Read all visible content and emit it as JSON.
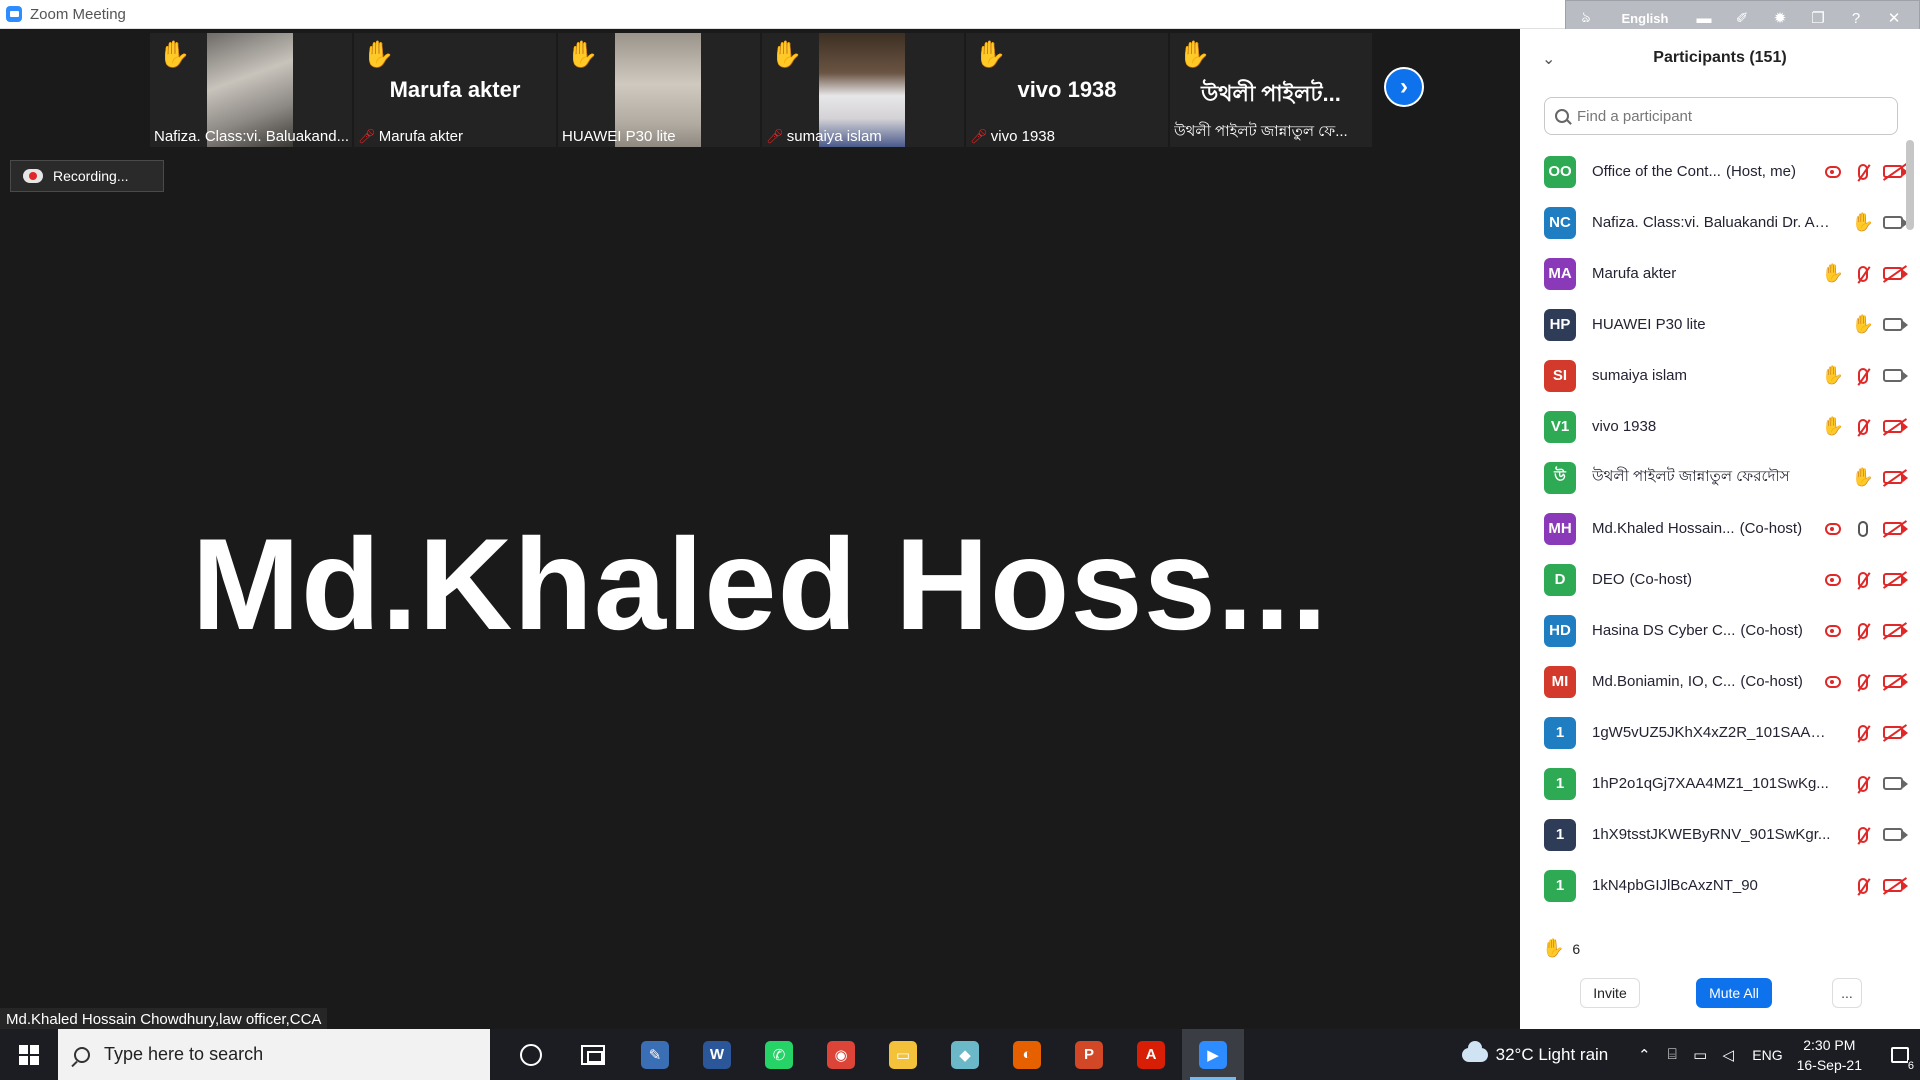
{
  "window": {
    "title": "Zoom Meeting"
  },
  "langbar": {
    "language": "English"
  },
  "thumbnails": [
    {
      "display": "photo",
      "name": "Nafiza. Class:vi. Baluakand...",
      "muted": false
    },
    {
      "display": "name",
      "big_name": "Marufa akter",
      "name": "Marufa akter",
      "muted": true
    },
    {
      "display": "photo",
      "name": "HUAWEI P30 lite",
      "muted": false
    },
    {
      "display": "photo",
      "name": "sumaiya islam",
      "muted": true
    },
    {
      "display": "name",
      "big_name": "vivo 1938",
      "name": "vivo 1938",
      "muted": true
    },
    {
      "display": "name",
      "big_name": "উথলী পাইলট...",
      "name": "উথলী পাইলট জান্নাতুল ফে...",
      "muted": false
    }
  ],
  "recording": {
    "label": "Recording..."
  },
  "active_speaker": {
    "big_name": "Md.Khaled  Hoss...",
    "name_label": "Md.Khaled Hossain Chowdhury,law officer,CCA"
  },
  "participants_panel": {
    "title": "Participants (151)",
    "search_placeholder": "Find a participant",
    "participants": [
      {
        "initials": "OO",
        "color": "#2eaa55",
        "name": "Office of the Cont...",
        "role": "(Host, me)",
        "rec": true,
        "hand": false,
        "mic": "off",
        "cam": "off"
      },
      {
        "initials": "NC",
        "color": "#1f7ec1",
        "name": "Nafiza. Class:vi. Baluakandi Dr. Ab...",
        "role": "",
        "rec": false,
        "hand": true,
        "mic": "none",
        "cam": "on"
      },
      {
        "initials": "MA",
        "color": "#8a3ab9",
        "name": "Marufa akter",
        "role": "",
        "rec": false,
        "hand": true,
        "mic": "off",
        "cam": "off"
      },
      {
        "initials": "HP",
        "color": "#2f3c58",
        "name": "HUAWEI P30 lite",
        "role": "",
        "rec": false,
        "hand": true,
        "mic": "none",
        "cam": "on"
      },
      {
        "initials": "SI",
        "color": "#d33a2c",
        "name": "sumaiya islam",
        "role": "",
        "rec": false,
        "hand": true,
        "mic": "off",
        "cam": "on"
      },
      {
        "initials": "V1",
        "color": "#2eaa55",
        "name": "vivo 1938",
        "role": "",
        "rec": false,
        "hand": true,
        "mic": "off",
        "cam": "off"
      },
      {
        "initials": "উ",
        "color": "#2eaa55",
        "name": "উথলী পাইলট জান্নাতুল ফেরদৌস",
        "role": "",
        "rec": false,
        "hand": true,
        "mic": "none",
        "cam": "off"
      },
      {
        "initials": "MH",
        "color": "#8a3ab9",
        "name": "Md.Khaled Hossain...",
        "role": "(Co-host)",
        "rec": true,
        "hand": false,
        "mic": "on",
        "cam": "off"
      },
      {
        "initials": "D",
        "color": "#2eaa55",
        "name": "DEO",
        "role": "(Co-host)",
        "rec": true,
        "hand": false,
        "mic": "off",
        "cam": "off"
      },
      {
        "initials": "HD",
        "color": "#1f7ec1",
        "name": "Hasina DS Cyber C...",
        "role": "(Co-host)",
        "rec": true,
        "hand": false,
        "mic": "off",
        "cam": "off"
      },
      {
        "initials": "MI",
        "color": "#d33a2c",
        "name": "Md.Boniamin, IO, C...",
        "role": "(Co-host)",
        "rec": true,
        "hand": false,
        "mic": "off",
        "cam": "off"
      },
      {
        "initials": "1",
        "color": "#1f7ec1",
        "name": "1gW5vUZ5JKhX4xZ2R_101SAAA...",
        "role": "",
        "rec": false,
        "hand": false,
        "mic": "off",
        "cam": "off"
      },
      {
        "initials": "1",
        "color": "#2eaa55",
        "name": "1hP2o1qGj7XAA4MZ1_101SwKg...",
        "role": "",
        "rec": false,
        "hand": false,
        "mic": "off",
        "cam": "on"
      },
      {
        "initials": "1",
        "color": "#2f3c58",
        "name": "1hX9tsstJKWEByRNV_901SwKgr...",
        "role": "",
        "rec": false,
        "hand": false,
        "mic": "off",
        "cam": "on"
      },
      {
        "initials": "1",
        "color": "#2eaa55",
        "name": "1kN4pbGIJlBcAxzNT_90",
        "role": "",
        "rec": false,
        "hand": false,
        "mic": "off",
        "cam": "off"
      }
    ],
    "raised_hands_count": "6",
    "invite_label": "Invite",
    "mute_all_label": "Mute All",
    "more_label": "..."
  },
  "taskbar": {
    "search_placeholder": "Type here to search",
    "apps": [
      {
        "name": "paint-icon",
        "glyph": "✎",
        "color": "#3a6fb5"
      },
      {
        "name": "word-icon",
        "glyph": "W",
        "color": "#2b579a"
      },
      {
        "name": "whatsapp-icon",
        "glyph": "✆",
        "color": "#25d366"
      },
      {
        "name": "chrome-icon",
        "glyph": "◉",
        "color": "#db4437"
      },
      {
        "name": "file-explorer-icon",
        "glyph": "▭",
        "color": "#f3c13a"
      },
      {
        "name": "notes-icon",
        "glyph": "◆",
        "color": "#6bb8c9"
      },
      {
        "name": "firefox-icon",
        "glyph": "◐",
        "color": "#e66000"
      },
      {
        "name": "powerpoint-icon",
        "glyph": "P",
        "color": "#d24726"
      },
      {
        "name": "acrobat-icon",
        "glyph": "A",
        "color": "#d81e05"
      },
      {
        "name": "zoom-icon",
        "glyph": "▶",
        "color": "#2d8cff"
      }
    ],
    "weather": "32°C  Light rain",
    "input_lang": "ENG",
    "time": "2:30 PM",
    "date": "16-Sep-21",
    "notification_count": "6"
  }
}
